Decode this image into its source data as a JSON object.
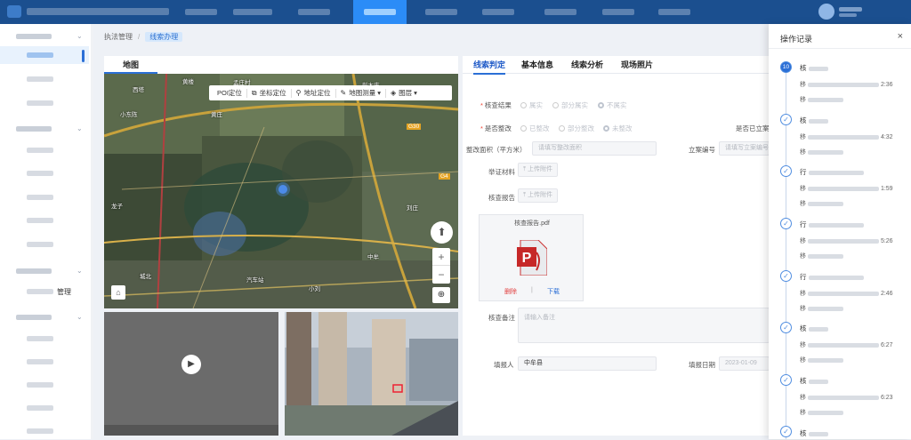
{
  "breadcrumb": {
    "root": "执法管理",
    "separator": "/",
    "current": "线索办理"
  },
  "sidebar": {
    "items": [
      "管理"
    ]
  },
  "map_panel": {
    "tab": "地图",
    "toolbar": {
      "poi": "POI定位",
      "coord": "坐标定位",
      "address": "地址定位",
      "measure": "地图测量",
      "layers": "图层"
    },
    "labels": [
      "孟庄村",
      "黄楼",
      "西塔",
      "彭木庄",
      "小东陈",
      "G30",
      "G4",
      "黄庄",
      "龙子",
      "刘庄",
      "城北",
      "汽车站",
      "小刘",
      "中牟"
    ]
  },
  "form": {
    "tabs": [
      "线索判定",
      "基本信息",
      "线索分析",
      "现场照片"
    ],
    "check_result": {
      "label": "核查结果",
      "options": [
        "属实",
        "部分属实",
        "不属实"
      ]
    },
    "rectified": {
      "label": "是否整改",
      "options": [
        "已整改",
        "部分整改",
        "未整改"
      ]
    },
    "filed_label": "是否已立案",
    "area": {
      "label": "整改面积（平方米）",
      "placeholder": "请填写整改面积"
    },
    "case_no": {
      "label": "立案编号",
      "placeholder": "请填写立案编号"
    },
    "evidence": {
      "label": "举证材料",
      "button": "上传附件"
    },
    "report": {
      "label": "核查报告",
      "button": "上传附件"
    },
    "attachment": {
      "file_name": "核查报告.pdf",
      "delete": "删除",
      "sep": "|",
      "download": "下载"
    },
    "remark": {
      "label": "核查备注",
      "placeholder": "请输入备注"
    },
    "reporter": {
      "label": "填报人",
      "value": "中牟县"
    },
    "report_date": {
      "label": "填报日期",
      "value": "2023-01-09"
    }
  },
  "oplog": {
    "title": "操作记录",
    "close": "×",
    "entries": [
      {
        "node": "10",
        "title": "核",
        "line1": "移",
        "time": "2:36",
        "line2": "移"
      },
      {
        "node": "✓",
        "title": "核",
        "line1": "移",
        "time": "4:32",
        "line2": "移"
      },
      {
        "node": "✓",
        "title": "行",
        "line1": "移",
        "time": "1:59",
        "line2": "移"
      },
      {
        "node": "✓",
        "title": "行",
        "line1": "移",
        "time": "5:26",
        "line2": "移"
      },
      {
        "node": "✓",
        "title": "行",
        "line1": "移",
        "time": "2:46",
        "line2": "移"
      },
      {
        "node": "✓",
        "title": "核",
        "line1": "移",
        "time": "6:27",
        "line2": "移"
      },
      {
        "node": "✓",
        "title": "核",
        "line1": "移",
        "time": "6:23",
        "line2": "移"
      },
      {
        "node": "✓",
        "title": "核",
        "line1": "",
        "time": "",
        "line2": ""
      }
    ]
  },
  "colors": {
    "accent": "#2b6fd6",
    "topbar": "#1b4f8f",
    "danger": "#e13d3d"
  }
}
